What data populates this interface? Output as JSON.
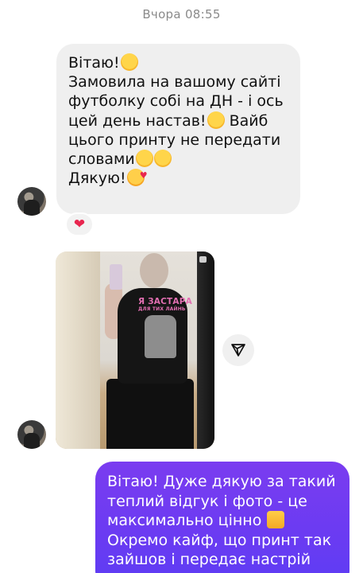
{
  "thread": {
    "timestamp": "Вчора 08:55"
  },
  "incoming_message": {
    "lines": [
      "Вітаю!",
      "Замовила на вашому сайті",
      "футболку собі на ДН - і ось",
      "цей день настав!",
      " Вайб",
      "цього принту не передати",
      "словами",
      "Дякую!"
    ],
    "emojis": [
      "hugging-face-emoji",
      "grinning-face-emoji",
      "face-with-hand-over-mouth-emoji",
      "grinning-face-emoji",
      "smiling-face-with-hearts-emoji"
    ],
    "reaction": "❤"
  },
  "photo_message": {
    "print_lines": [
      "Я ЗАСТАРА",
      "ДЛЯ ТИХ ЛАЙНЬ"
    ]
  },
  "outgoing_message": {
    "lines": [
      "Вітаю! Дуже дякую за такий",
      "теплий відгук і фото - це",
      "максимально цінно",
      "Окремо кайф, що принт так",
      "зайшов і передає настрій"
    ],
    "emojis": [
      "raising-hands-emoji"
    ]
  },
  "colors": {
    "incoming_bubble": "#efefef",
    "outgoing_bubble_top": "#7a3cf0",
    "outgoing_bubble_bottom": "#5c3df4",
    "reaction_heart": "#e8264f",
    "timestamp_text": "#8a8a8a"
  }
}
